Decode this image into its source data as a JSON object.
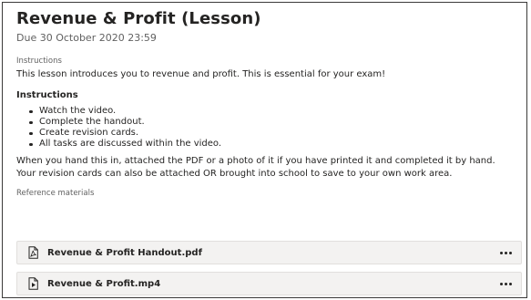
{
  "assignment": {
    "title": "Revenue & Profit (Lesson)",
    "due": "Due 30 October 2020 23:59"
  },
  "instructions": {
    "section_label": "Instructions",
    "intro": "This lesson introduces you to revenue and profit. This is essential for your exam!",
    "heading": "Instructions",
    "tasks": [
      "Watch the video.",
      "Complete the handout.",
      "Create revision cards.",
      "All tasks are discussed within the video."
    ],
    "closing_lines": [
      "When you hand this in, attached the PDF or a photo of it if you have printed it and completed it by hand.",
      "Your revision cards can also be attached OR brought into school to save to your own work area."
    ]
  },
  "reference_materials": {
    "label": "Reference materials",
    "items": [
      {
        "name": "Revenue & Profit Handout.pdf",
        "icon": "pdf-file-icon"
      },
      {
        "name": "Revenue & Profit.mp4",
        "icon": "video-file-icon"
      }
    ]
  }
}
